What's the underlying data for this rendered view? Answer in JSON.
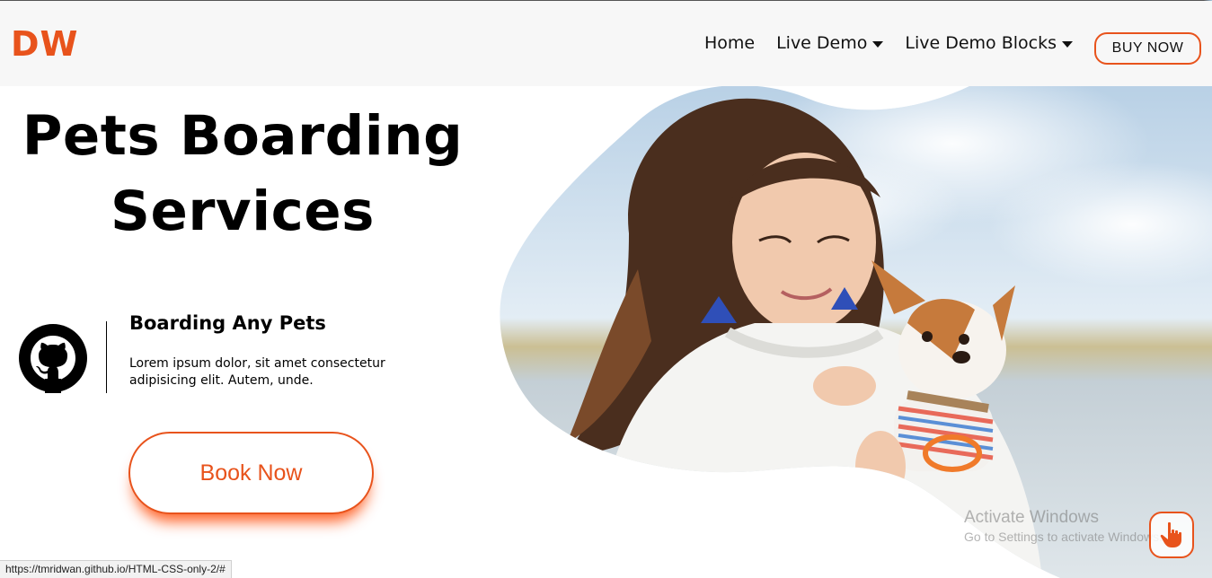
{
  "navbar": {
    "logo": "DW",
    "links": [
      {
        "label": "Home"
      },
      {
        "label": "Live Demo"
      },
      {
        "label": "Live Demo Blocks"
      }
    ],
    "buy_button": "BUY NOW"
  },
  "hero": {
    "title_line1": "Pets Boarding",
    "title_line2": "Services",
    "feature": {
      "icon": "github-icon",
      "title": "Boarding Any Pets",
      "text": "Lorem ipsum dolor, sit amet consectetur adipisicing elit. Autem, unde."
    },
    "book_button": "Book Now"
  },
  "watermark": {
    "line1": "Activate Windows",
    "line2": "Go to Settings to activate Windows."
  },
  "status_url": "https://tmridwan.github.io/HTML-CSS-only-2/#",
  "colors": {
    "accent": "#e8531c",
    "navbar_bg": "#f7f7f7",
    "text": "#000000"
  }
}
